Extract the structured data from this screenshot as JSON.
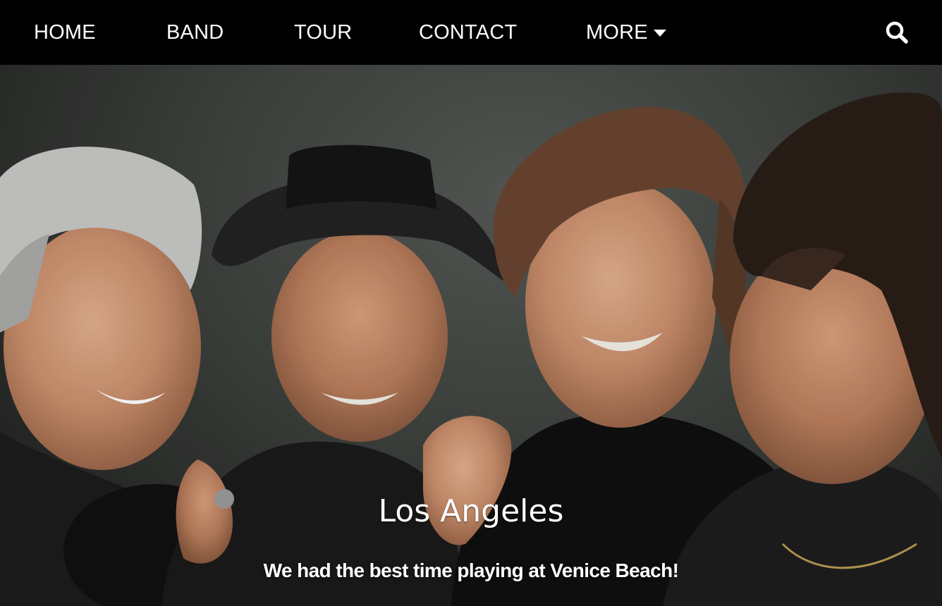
{
  "nav": {
    "items": [
      {
        "label": "HOME"
      },
      {
        "label": "BAND"
      },
      {
        "label": "TOUR"
      },
      {
        "label": "CONTACT"
      },
      {
        "label": "MORE"
      }
    ],
    "search_icon": "search-icon",
    "more_icon": "caret-down-icon"
  },
  "slide": {
    "caption_title": "Los Angeles",
    "caption_text": "We had the best time playing at Venice Beach!",
    "image": "band-photo"
  },
  "colors": {
    "navbar_bg": "#000000",
    "nav_text": "#ffffff",
    "backdrop": "#474b47"
  }
}
